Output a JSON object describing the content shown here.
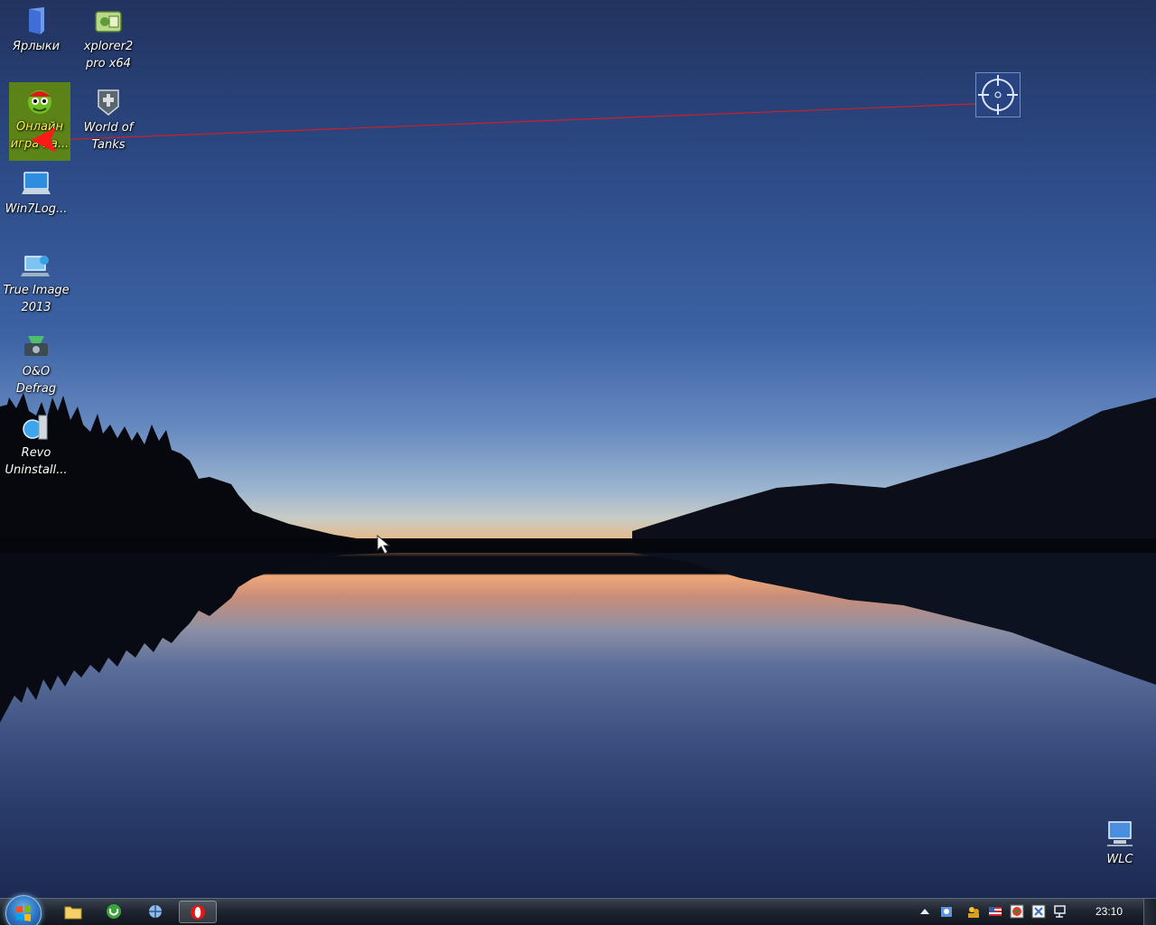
{
  "desktop": {
    "icons": [
      {
        "label": "Ярлыки",
        "icon": "folder-icon"
      },
      {
        "label": "xplorer2 pro x64",
        "icon": "xplorer2-icon"
      },
      {
        "label": "Онлайн игра на...",
        "icon": "online-game-icon",
        "selected": true
      },
      {
        "label": "World of Tanks",
        "icon": "world-of-tanks-icon"
      },
      {
        "label": "Win7Log...",
        "icon": "win7logon-icon"
      },
      {
        "label": "True Image 2013",
        "icon": "true-image-icon"
      },
      {
        "label": "O&O Defrag",
        "icon": "oo-defrag-icon"
      },
      {
        "label": "Revo Uninstall...",
        "icon": "revo-uninstaller-icon"
      },
      {
        "label": "WLC",
        "icon": "wlc-icon"
      }
    ]
  },
  "overlay": {
    "target_icon": "crosshair-target-icon",
    "pointer_icon": "red-arrow-pointer-icon",
    "line_color": "#d01e2a"
  },
  "taskbar": {
    "start_icon": "windows-start-orb-icon",
    "pinned": [
      {
        "name": "explorer",
        "icon": "folder-icon"
      },
      {
        "name": "utorrent",
        "icon": "utorrent-icon"
      },
      {
        "name": "network-tool",
        "icon": "network-icon"
      },
      {
        "name": "opera",
        "icon": "opera-icon",
        "active": true
      }
    ],
    "tray": {
      "icons": [
        "show-hidden-icons-chevron",
        "network-manager-icon",
        "users-icon",
        "flag-language-icon",
        "antivirus-icon",
        "process-icon",
        "network-monitor-icon"
      ],
      "clock": "23:10"
    }
  },
  "colors": {
    "selection": "#628c0a",
    "taskbar": "#1f2630",
    "label_text": "#ffffff"
  }
}
